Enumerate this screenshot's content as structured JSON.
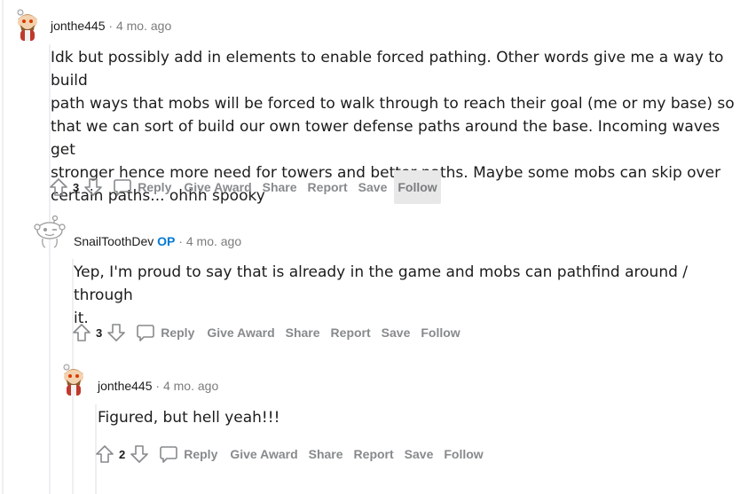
{
  "comments": [
    {
      "author": "jonthe445",
      "op_badge": "",
      "separator": "·",
      "time": "4 mo. ago",
      "body_lines": [
        "Idk but possibly add in elements to enable forced pathing. Other words give me a way to build",
        "path ways that mobs will be forced to walk through to reach their goal (me or my base) so",
        "that we can sort of build our own tower defense paths around the base. Incoming waves get",
        "stronger hence more need for towers and better paths. Maybe some mobs can skip over",
        "certain paths... ohhh spooky"
      ],
      "score": "3",
      "actions": {
        "reply": "Reply",
        "award": "Give Award",
        "share": "Share",
        "report": "Report",
        "save": "Save",
        "follow": "Follow"
      }
    },
    {
      "author": "SnailToothDev",
      "op_badge": "OP",
      "separator": "·",
      "time": "4 mo. ago",
      "body_lines": [
        "Yep, I'm proud to say that is already in the game and mobs can pathfind around / through",
        "it."
      ],
      "score": "3",
      "actions": {
        "reply": "Reply",
        "award": "Give Award",
        "share": "Share",
        "report": "Report",
        "save": "Save",
        "follow": "Follow"
      }
    },
    {
      "author": "jonthe445",
      "op_badge": "",
      "separator": "·",
      "time": "4 mo. ago",
      "body_lines": [
        "Figured, but hell yeah!!!"
      ],
      "score": "2",
      "actions": {
        "reply": "Reply",
        "award": "Give Award",
        "share": "Share",
        "report": "Report",
        "save": "Save",
        "follow": "Follow"
      }
    }
  ],
  "icons": {
    "upvote": "upvote-arrow-icon",
    "downvote": "downvote-arrow-icon",
    "reply": "speech-bubble-icon",
    "avatar_user": "snoo-avatar-icon"
  },
  "colors": {
    "op": "#0079d3",
    "action": "#878a8c",
    "thread": "#edeff1",
    "follow_hover": "#e8e8e8"
  }
}
